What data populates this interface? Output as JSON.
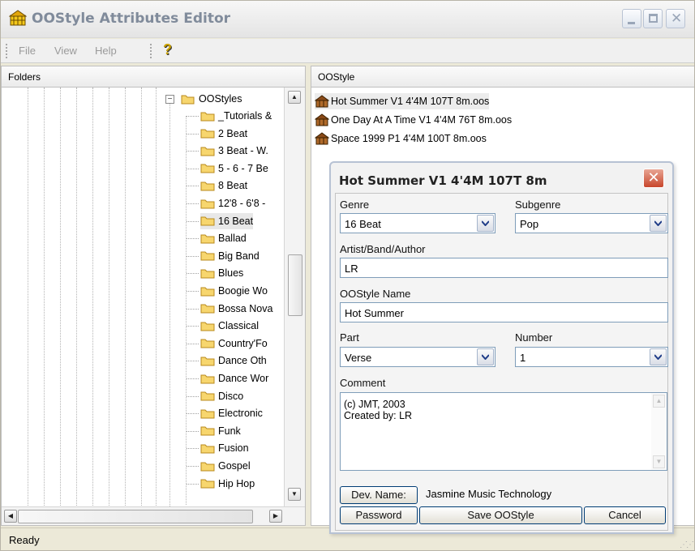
{
  "window": {
    "title": "OOStyle Attributes Editor"
  },
  "menu": {
    "file": "File",
    "view": "View",
    "help": "Help"
  },
  "panes": {
    "folders_header": "Folders",
    "files_header": "OOStyle"
  },
  "tree": {
    "root": "OOStyles",
    "items": [
      "_Tutorials &",
      "2 Beat",
      "3 Beat - W.",
      "5 - 6 - 7 Be",
      "8 Beat",
      "12'8 - 6'8 -",
      "16 Beat",
      "Ballad",
      "Big Band",
      "Blues",
      "Boogie Wo",
      "Bossa Nova",
      "Classical",
      "Country'Fo",
      "Dance Oth",
      "Dance Wor",
      "Disco",
      "Electronic",
      "Funk",
      "Fusion",
      "Gospel",
      "Hip Hop"
    ],
    "selected_index": 6
  },
  "files": [
    "Hot Summer V1 4'4M 107T 8m.oos",
    "One Day At A Time V1 4'4M 76T 8m.oos",
    "Space 1999 P1 4'4M 100T 8m.oos"
  ],
  "status": {
    "text": "Ready"
  },
  "dialog": {
    "title": "Hot Summer V1 4'4M 107T 8m",
    "genre_label": "Genre",
    "genre_value": "16 Beat",
    "subgenre_label": "Subgenre",
    "subgenre_value": "Pop",
    "artist_label": "Artist/Band/Author",
    "artist_value": "LR",
    "name_label": "OOStyle Name",
    "name_value": "Hot Summer",
    "part_label": "Part",
    "part_value": "Verse",
    "number_label": "Number",
    "number_value": "1",
    "comment_label": "Comment",
    "comment_line1": "(c) JMT, 2003",
    "comment_line2": "Created by: LR",
    "dev_name_button": "Dev. Name:",
    "dev_name_value": "Jasmine Music Technology",
    "password_button": "Password",
    "save_button": "Save OOStyle",
    "cancel_button": "Cancel"
  }
}
